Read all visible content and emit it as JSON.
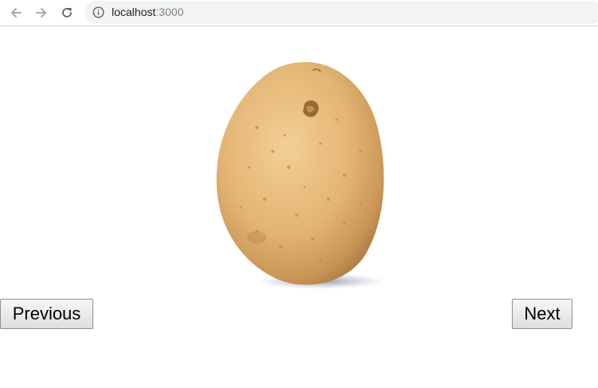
{
  "browser": {
    "url_host": "localhost",
    "url_port": ":3000"
  },
  "icons": {
    "back": "arrow-left-icon",
    "forward": "arrow-right-icon",
    "reload": "reload-icon",
    "info": "info-icon"
  },
  "page": {
    "image": "potato",
    "previous_label": "Previous",
    "next_label": "Next"
  }
}
